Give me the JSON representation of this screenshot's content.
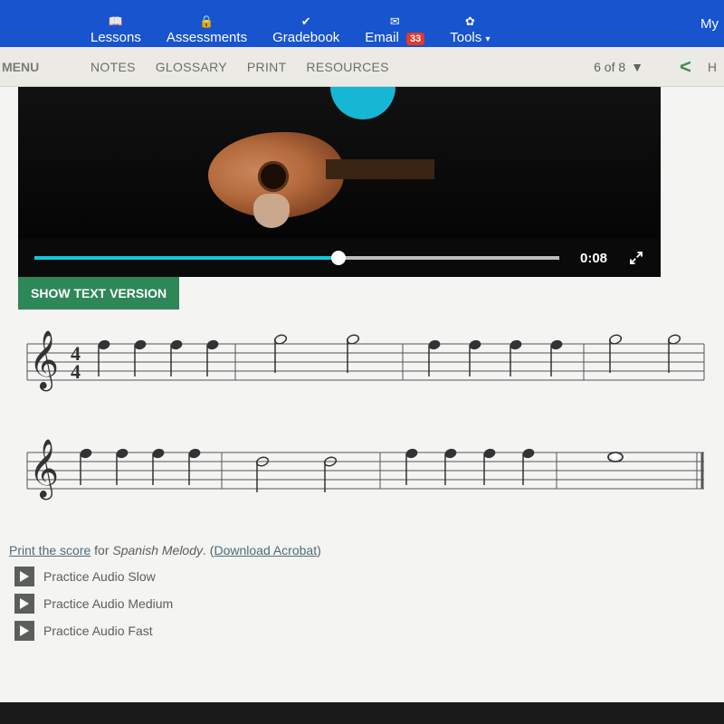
{
  "topnav": {
    "lessons": "Lessons",
    "assessments": "Assessments",
    "gradebook": "Gradebook",
    "email": "Email",
    "email_badge": "33",
    "tools": "Tools",
    "my": "My"
  },
  "secnav": {
    "menu": "MENU",
    "notes": "NOTES",
    "glossary": "GLOSSARY",
    "print": "PRINT",
    "resources": "RESOURCES",
    "pager": "6 of 8",
    "h": "H"
  },
  "video": {
    "time": "0:08"
  },
  "show_text_version": "SHOW TEXT VERSION",
  "meta": {
    "print_link": "Print the score",
    "for_text": " for ",
    "piece": "Spanish Melody",
    "paren_open": ". (",
    "acrobat": "Download Acrobat",
    "paren_close": ")"
  },
  "audio": {
    "slow": "Practice Audio Slow",
    "medium": "Practice Audio Medium",
    "fast": "Practice Audio Fast"
  }
}
